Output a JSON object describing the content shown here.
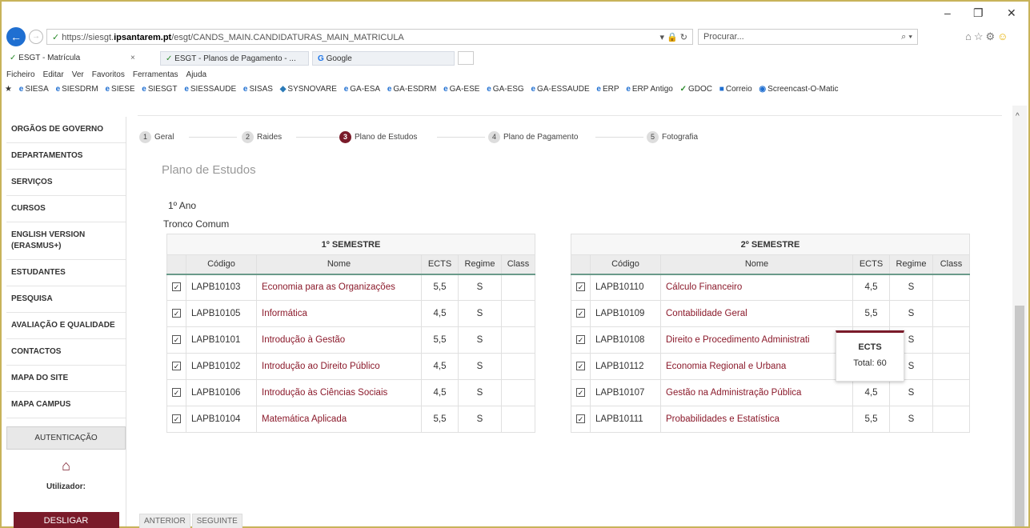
{
  "browser": {
    "url_prefix": "https://siesgt.",
    "url_domain": "ipsantarem.pt",
    "url_path": "/esgt/CANDS_MAIN.CANDIDATURAS_MAIN_MATRICULA",
    "search_placeholder": "Procurar...",
    "tabs": [
      {
        "label": "ESGT - Matrícula"
      },
      {
        "label": "ESGT - Planos de Pagamento - ..."
      },
      {
        "label": "Google"
      }
    ],
    "menu": [
      "Ficheiro",
      "Editar",
      "Ver",
      "Favoritos",
      "Ferramentas",
      "Ajuda"
    ],
    "favorites": [
      "SIESA",
      "SIESDRM",
      "SIESE",
      "SIESGT",
      "SIESSAUDE",
      "SISAS",
      "SYSNOVARE",
      "GA-ESA",
      "GA-ESDRM",
      "GA-ESE",
      "GA-ESG",
      "GA-ESSAUDE",
      "ERP",
      "ERP Antigo",
      "GDOC",
      "Correio",
      "Screencast-O-Matic"
    ]
  },
  "sidebar": {
    "items": [
      "ORGÃOS DE GOVERNO",
      "DEPARTAMENTOS",
      "SERVIÇOS",
      "CURSOS",
      "ENGLISH VERSION (ERASMUS+)",
      "ESTUDANTES",
      "PESQUISA",
      "AVALIAÇÃO E QUALIDADE",
      "CONTACTOS",
      "MAPA DO SITE",
      "MAPA CAMPUS"
    ],
    "auth_header": "AUTENTICAÇÃO",
    "user_label": "Utilizador:",
    "logout": "DESLIGAR"
  },
  "wizard": {
    "steps": [
      {
        "num": "1",
        "label": "Geral"
      },
      {
        "num": "2",
        "label": "Raides"
      },
      {
        "num": "3",
        "label": "Plano de Estudos"
      },
      {
        "num": "4",
        "label": "Plano de Pagamento"
      },
      {
        "num": "5",
        "label": "Fotografia"
      }
    ],
    "active_step": 3
  },
  "main": {
    "section_title": "Plano de Estudos",
    "year": "1º Ano",
    "trunk": "Tronco Comum",
    "columns": [
      "Código",
      "Nome",
      "ECTS",
      "Regime",
      "Class"
    ],
    "sem1": {
      "title": "1º SEMESTRE",
      "rows": [
        {
          "code": "LAPB10103",
          "name": "Economia para as Organizações",
          "ects": "5,5",
          "regime": "S",
          "class": ""
        },
        {
          "code": "LAPB10105",
          "name": "Informática",
          "ects": "4,5",
          "regime": "S",
          "class": ""
        },
        {
          "code": "LAPB10101",
          "name": "Introdução à Gestão",
          "ects": "5,5",
          "regime": "S",
          "class": ""
        },
        {
          "code": "LAPB10102",
          "name": "Introdução ao Direito Público",
          "ects": "4,5",
          "regime": "S",
          "class": ""
        },
        {
          "code": "LAPB10106",
          "name": "Introdução às Ciências Sociais",
          "ects": "4,5",
          "regime": "S",
          "class": ""
        },
        {
          "code": "LAPB10104",
          "name": "Matemática Aplicada",
          "ects": "5,5",
          "regime": "S",
          "class": ""
        }
      ]
    },
    "sem2": {
      "title": "2º SEMESTRE",
      "rows": [
        {
          "code": "LAPB10110",
          "name": "Cálculo Financeiro",
          "ects": "4,5",
          "regime": "S",
          "class": ""
        },
        {
          "code": "LAPB10109",
          "name": "Contabilidade Geral",
          "ects": "5,5",
          "regime": "S",
          "class": ""
        },
        {
          "code": "LAPB10108",
          "name": "Direito e Procedimento Administrati",
          "ects": "",
          "regime": "S",
          "class": ""
        },
        {
          "code": "LAPB10112",
          "name": "Economia Regional e Urbana",
          "ects": "",
          "regime": "S",
          "class": ""
        },
        {
          "code": "LAPB10107",
          "name": "Gestão na Administração Pública",
          "ects": "4,5",
          "regime": "S",
          "class": ""
        },
        {
          "code": "LAPB10111",
          "name": "Probabilidades e Estatística",
          "ects": "5,5",
          "regime": "S",
          "class": ""
        }
      ]
    },
    "ects_tooltip": {
      "title": "ECTS",
      "total": "Total: 60"
    },
    "nav": {
      "prev": "ANTERIOR",
      "next": "SEGUINTE"
    }
  }
}
